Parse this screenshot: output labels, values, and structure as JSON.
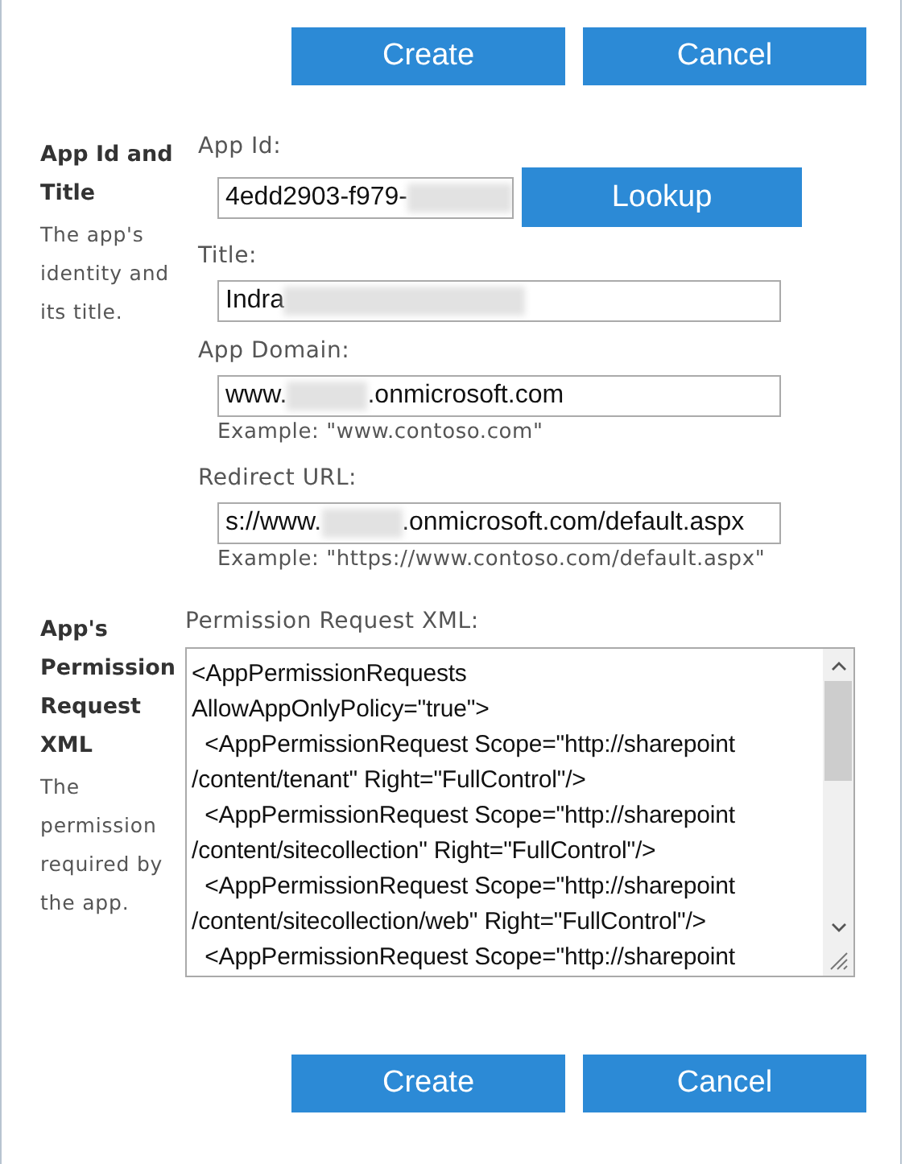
{
  "top_buttons": [
    {
      "label": "Create"
    },
    {
      "label": "Cancel"
    }
  ],
  "sections": [
    {
      "heading": "App Id and Title",
      "description": "The app's identity and its title.",
      "fields": [
        {
          "kind": "lookup",
          "label": "App Id:",
          "value_parts": [
            "4edd2903-f979-"
          ],
          "redacted_end": true,
          "button": "Lookup"
        },
        {
          "kind": "text",
          "label": "Title:",
          "value_parts": [
            "Indra"
          ],
          "redacted_end": true
        },
        {
          "kind": "text",
          "label": "App Domain:",
          "value_parts": [
            "www.",
            ".onmicrosoft.com"
          ],
          "redacted_end": false,
          "hint": "Example: \"www.contoso.com\""
        },
        {
          "kind": "text",
          "label": "Redirect URL:",
          "value_parts": [
            "s://www.",
            ".onmicrosoft.com/default.aspx"
          ],
          "redacted_end": false,
          "hint": "Example: \"https://www.contoso.com/default.aspx\""
        }
      ]
    },
    {
      "heading": "App's Permission Request XML",
      "description": "The permission required by the app.",
      "fields": [
        {
          "kind": "textarea",
          "label": "Permission Request XML:",
          "lines": [
            "<AppPermissionRequests",
            "AllowAppOnlyPolicy=\"true\">",
            "  <AppPermissionRequest Scope=\"http://sharepoint",
            "/content/tenant\" Right=\"FullControl\"/>",
            "  <AppPermissionRequest Scope=\"http://sharepoint",
            "/content/sitecollection\" Right=\"FullControl\"/>",
            "  <AppPermissionRequest Scope=\"http://sharepoint",
            "/content/sitecollection/web\" Right=\"FullControl\"/>",
            "  <AppPermissionRequest Scope=\"http://sharepoint"
          ]
        }
      ]
    }
  ],
  "bottom_buttons": [
    {
      "label": "Create"
    },
    {
      "label": "Cancel"
    }
  ]
}
